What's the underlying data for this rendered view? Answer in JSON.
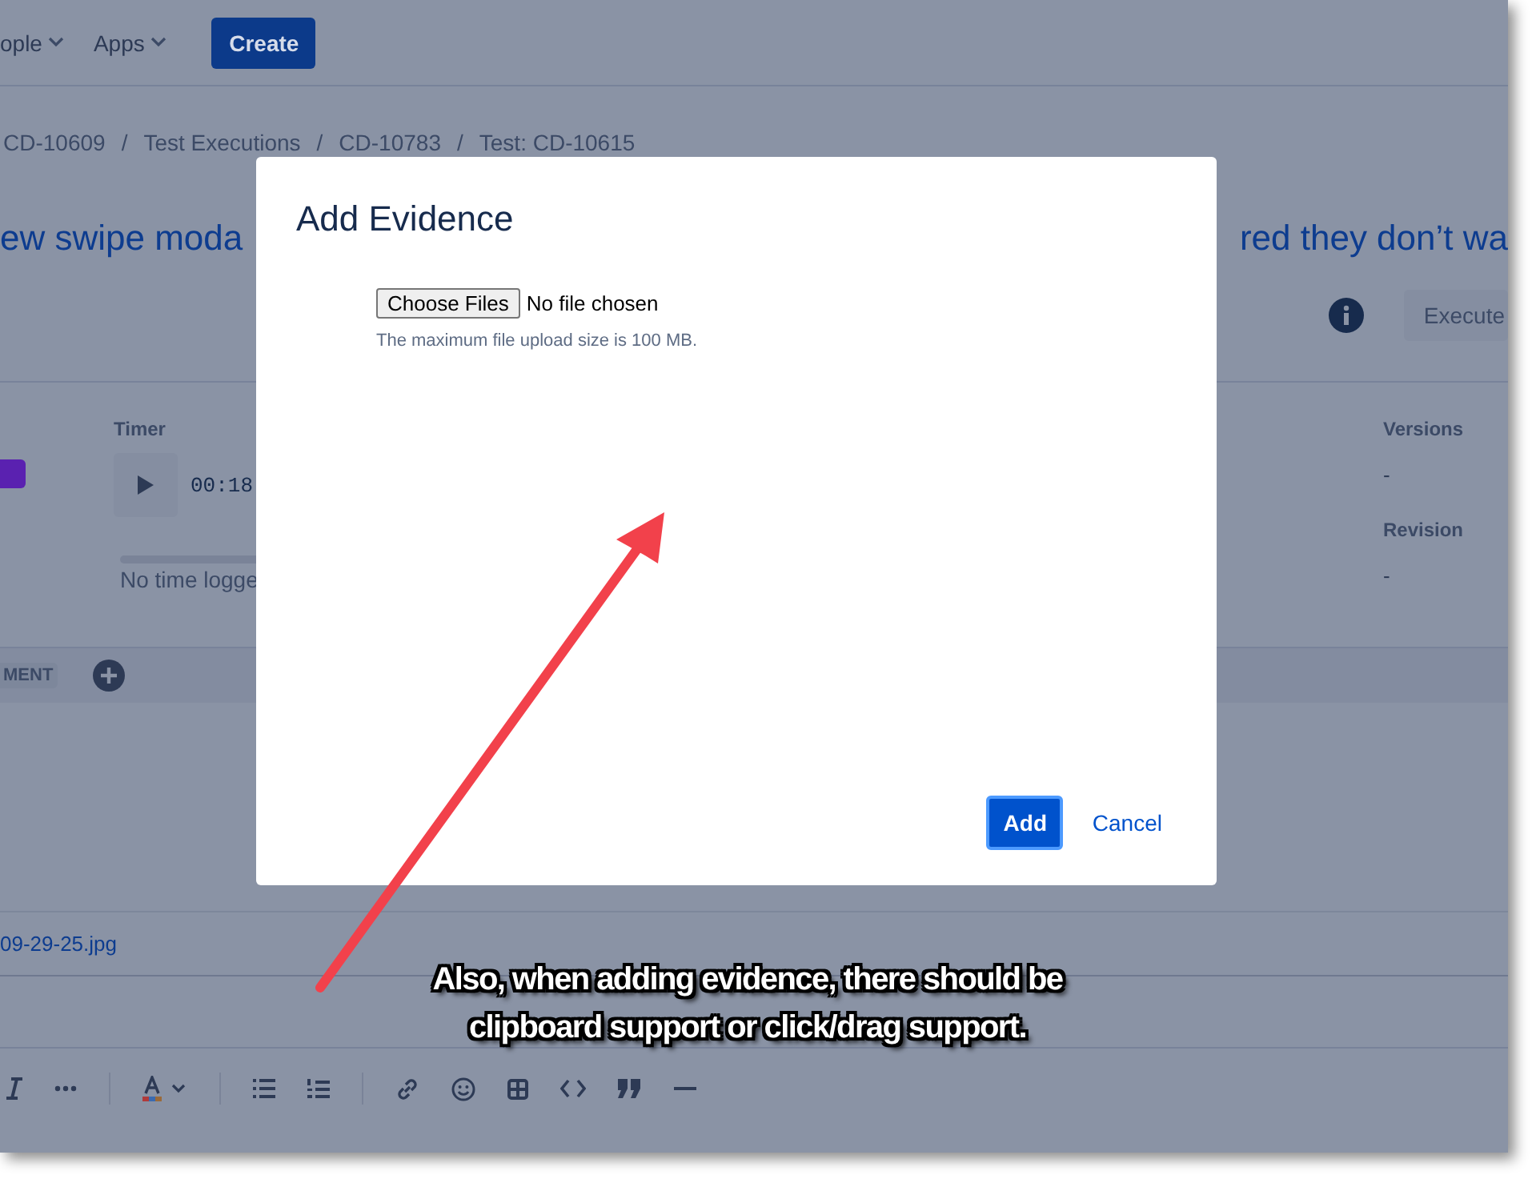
{
  "nav": {
    "items": [
      {
        "label": "ople"
      },
      {
        "label": "Apps"
      }
    ],
    "create_button": "Create"
  },
  "breadcrumbs": {
    "separator": "/",
    "items": [
      "CD-10609",
      "Test Executions",
      "CD-10783",
      "Test: CD-10615"
    ]
  },
  "title": {
    "left": "ew swipe moda",
    "right": "red they don’t wa"
  },
  "actions": {
    "execute_button": "Execute"
  },
  "timer": {
    "label": "Timer",
    "time": "00:18",
    "note": "No time logge",
    "level": 0
  },
  "fields": [
    {
      "label": "Versions",
      "value": "-"
    },
    {
      "label": "Revision",
      "value": "-"
    }
  ],
  "section": {
    "tag": "MENT"
  },
  "attachment": {
    "file": "09-29-25.jpg"
  },
  "toolbar": [
    {
      "kind": "italic"
    },
    {
      "kind": "more"
    },
    {
      "kind": "sep"
    },
    {
      "kind": "text-color"
    },
    {
      "kind": "sep"
    },
    {
      "kind": "bullet-list"
    },
    {
      "kind": "numbered-list"
    },
    {
      "kind": "sep"
    },
    {
      "kind": "link"
    },
    {
      "kind": "emoji"
    },
    {
      "kind": "table"
    },
    {
      "kind": "code"
    },
    {
      "kind": "quote"
    },
    {
      "kind": "rule"
    }
  ],
  "modal": {
    "title": "Add Evidence",
    "file_button": "Choose Files",
    "file_status": "No file chosen",
    "hint": "The maximum file upload size is 100 MB.",
    "primary_button": "Add",
    "cancel_link": "Cancel"
  },
  "annotation": {
    "caption_lines": [
      "Also, when adding evidence, there should be",
      "clipboard support or click/drag support."
    ]
  }
}
